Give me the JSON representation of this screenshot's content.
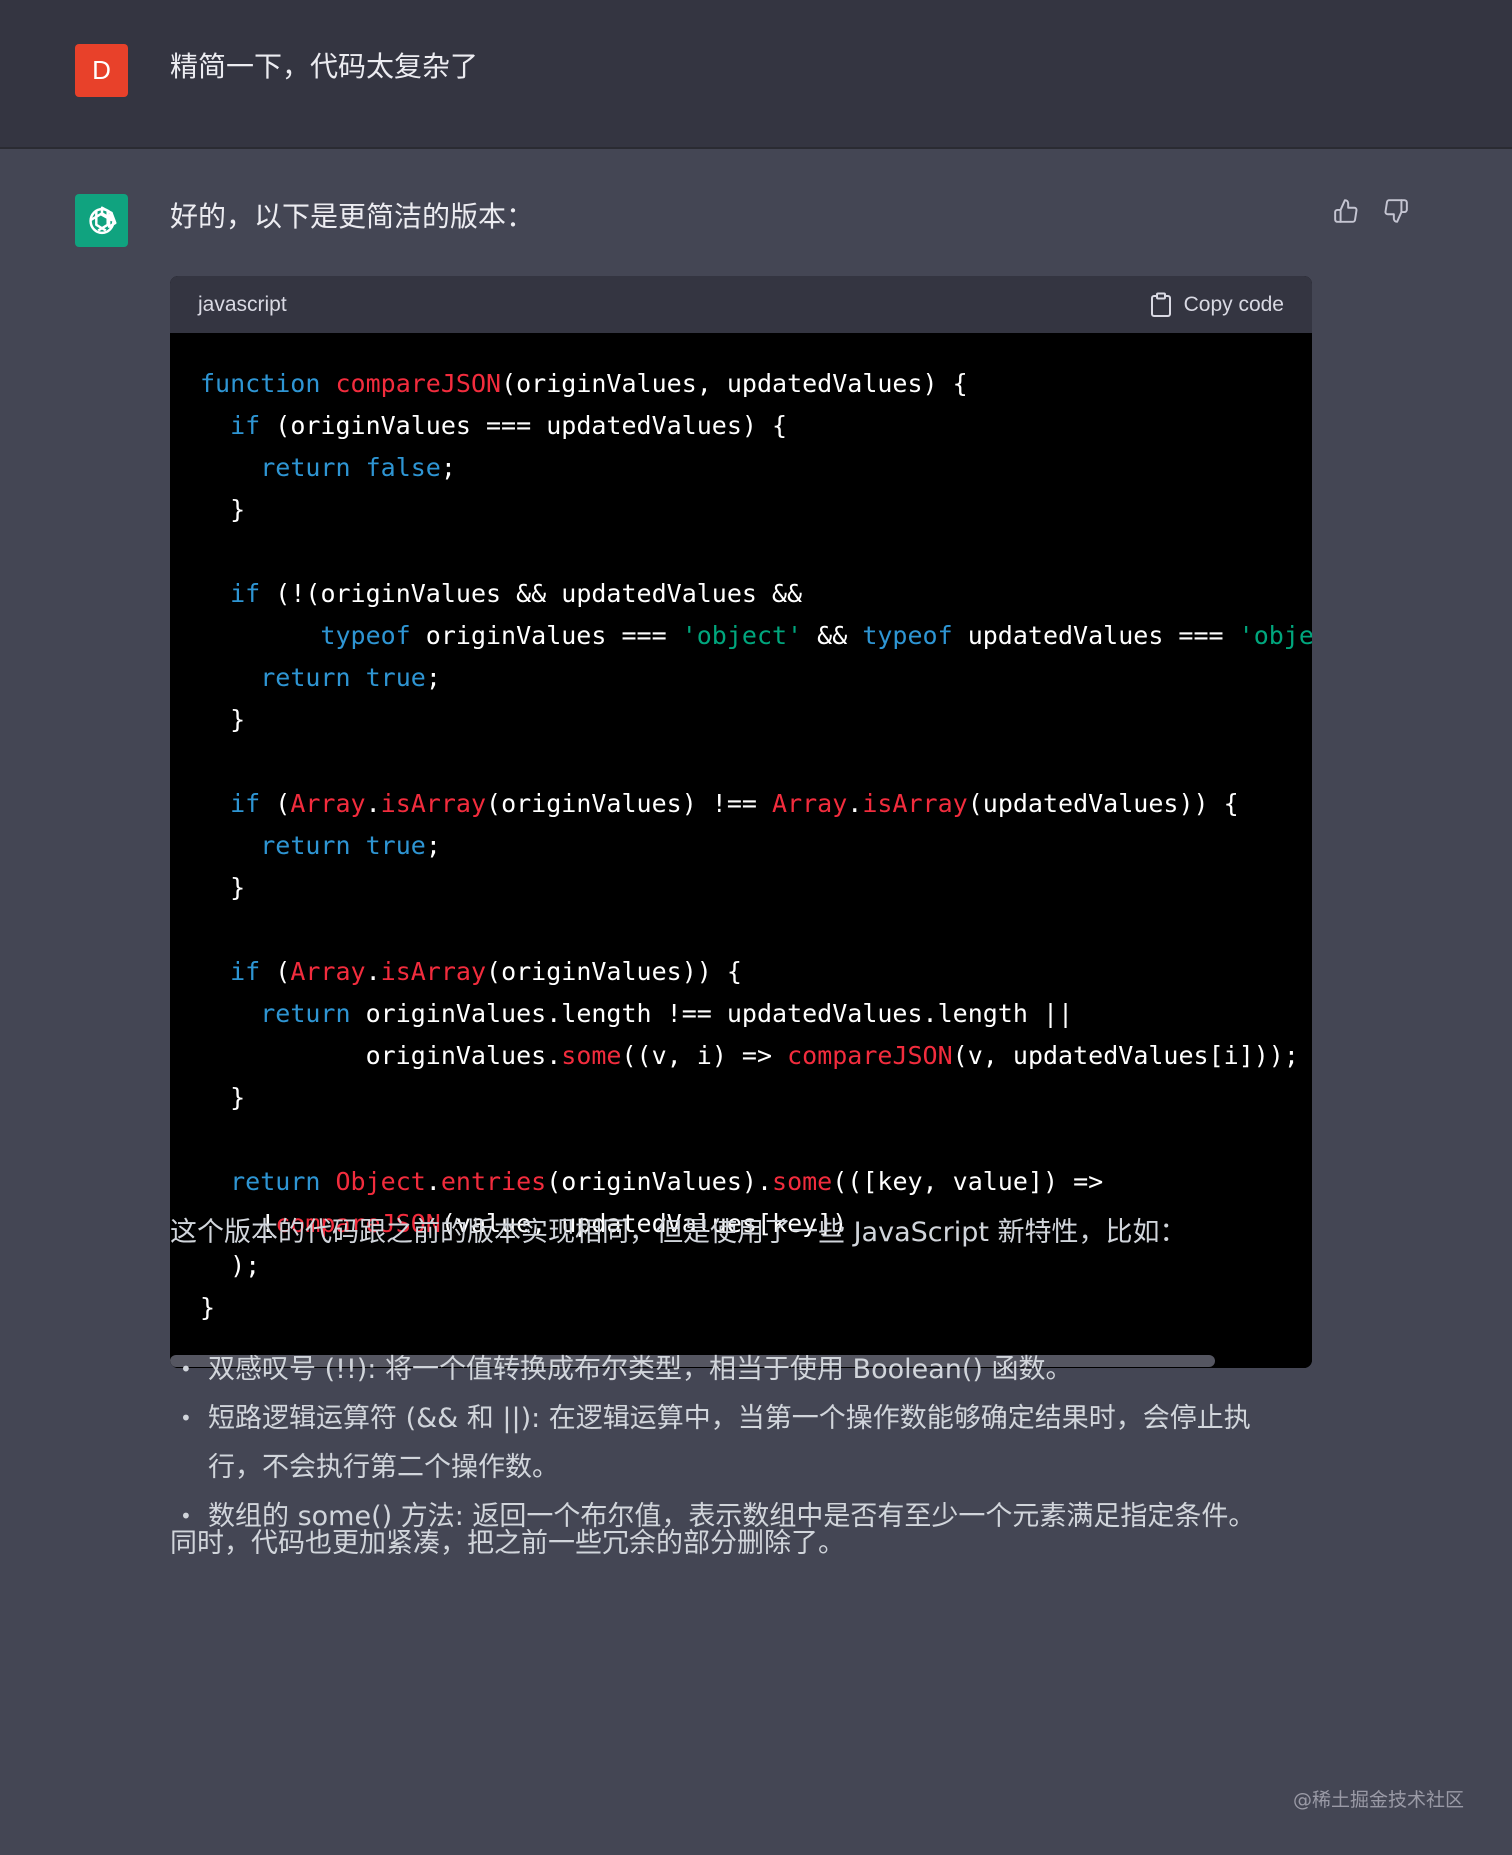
{
  "user": {
    "avatar_letter": "D",
    "message": "精简一下，代码太复杂了"
  },
  "assistant": {
    "intro": "好的，以下是更简洁的版本：",
    "feedback": {
      "thumbs_up": "thumbs-up-icon",
      "thumbs_down": "thumbs-down-icon"
    },
    "code_block": {
      "language": "javascript",
      "copy_label": "Copy code",
      "scroll_position": 0,
      "lines": [
        "function compareJSON(originValues, updatedValues) {",
        "  if (originValues === updatedValues) {",
        "    return false;",
        "  }",
        "",
        "  if (!(originValues && updatedValues &&",
        "        typeof originValues === 'object' && typeof updatedValues === 'object'",
        "    return true;",
        "  }",
        "",
        "  if (Array.isArray(originValues) !== Array.isArray(updatedValues)) {",
        "    return true;",
        "  }",
        "",
        "  if (Array.isArray(originValues)) {",
        "    return originValues.length !== updatedValues.length ||",
        "           originValues.some((v, i) => compareJSON(v, updatedValues[i]));",
        "  }",
        "",
        "  return Object.entries(originValues).some(([key, value]) =>",
        "    !compareJSON(value, updatedValues[key])",
        "  );",
        "}"
      ]
    },
    "explanation": "这个版本的代码跟之前的版本实现相同，但是使用了一些 JavaScript 新特性，比如：",
    "bullets": [
      "双感叹号 (!!): 将一个值转换成布尔类型，相当于使用 Boolean() 函数。",
      "短路逻辑运算符 (&& 和 ||): 在逻辑运算中，当第一个操作数能够确定结果时，会停止执",
      "行，不会执行第二个操作数。",
      "数组的 some() 方法: 返回一个布尔值，表示数组中是否有至少一个元素满足指定条件。"
    ],
    "conclusion": "同时，代码也更加紧凑，把之前一些冗余的部分删除了。"
  },
  "watermark": "@稀土掘金技术社区",
  "colors": {
    "page_bg": "#444654",
    "user_bg": "#343541",
    "user_avatar": "#e8412a",
    "bot_avatar": "#10a37f",
    "keyword": "#2e95d3",
    "function": "#f22c3d",
    "string": "#00a67d"
  }
}
